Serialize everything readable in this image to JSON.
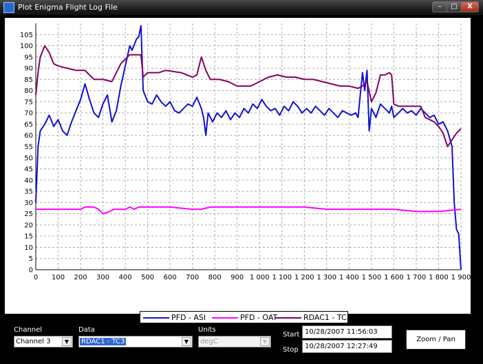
{
  "window": {
    "title": "Plot Enigma Flight Log File",
    "minimize_glyph": "–",
    "maximize_glyph": "□",
    "close_glyph": "X",
    "icon": "app-icon"
  },
  "legend": [
    {
      "name": "PFD - ASI",
      "color": "#1010d0"
    },
    {
      "name": "PFD - OAT",
      "color": "#ff00ff"
    },
    {
      "name": "RDAC1 - TC3",
      "color": "#800060"
    }
  ],
  "controls": {
    "channel": {
      "label": "Channel",
      "value": "Channel 3"
    },
    "data": {
      "label": "Data",
      "value": "RDAC1 - TC3"
    },
    "units": {
      "label": "Units",
      "value": "degC"
    },
    "start": {
      "label": "Start",
      "value": "10/28/2007 11:56:03"
    },
    "stop": {
      "label": "Stop",
      "value": "10/28/2007 12:27:49"
    },
    "zoom_button": "Zoom / Pan"
  },
  "chart_data": {
    "type": "line",
    "xlim": [
      0,
      1900
    ],
    "ylim": [
      0,
      110
    ],
    "grid": true,
    "legend_position": "bottom-center",
    "x_ticks": [
      0,
      100,
      200,
      300,
      400,
      500,
      600,
      700,
      800,
      900,
      1000,
      1100,
      1200,
      1300,
      1400,
      1500,
      1600,
      1700,
      1800,
      1900
    ],
    "x_tick_labels": [
      "0",
      "100",
      "200",
      "300",
      "400",
      "500",
      "600",
      "700",
      "800",
      "900",
      "1 000",
      "1 100",
      "1 200",
      "1 300",
      "1 400",
      "1 500",
      "1 600",
      "1 700",
      "1 800",
      "1 900"
    ],
    "y_ticks": [
      0,
      5,
      10,
      15,
      20,
      25,
      30,
      35,
      40,
      45,
      50,
      55,
      60,
      65,
      70,
      75,
      80,
      85,
      90,
      95,
      100,
      105
    ],
    "series": [
      {
        "name": "PFD - ASI",
        "color": "#1010d0",
        "points": [
          [
            0,
            30
          ],
          [
            10,
            55
          ],
          [
            20,
            62
          ],
          [
            40,
            65
          ],
          [
            60,
            69
          ],
          [
            80,
            64
          ],
          [
            100,
            67
          ],
          [
            120,
            62
          ],
          [
            140,
            60
          ],
          [
            160,
            66
          ],
          [
            180,
            71
          ],
          [
            200,
            76
          ],
          [
            220,
            83
          ],
          [
            240,
            76
          ],
          [
            260,
            70
          ],
          [
            280,
            68
          ],
          [
            300,
            74
          ],
          [
            320,
            78
          ],
          [
            340,
            66
          ],
          [
            360,
            71
          ],
          [
            380,
            82
          ],
          [
            400,
            91
          ],
          [
            420,
            100
          ],
          [
            430,
            98
          ],
          [
            450,
            103
          ],
          [
            460,
            104
          ],
          [
            470,
            109
          ],
          [
            480,
            80
          ],
          [
            500,
            75
          ],
          [
            520,
            74
          ],
          [
            540,
            78
          ],
          [
            560,
            75
          ],
          [
            580,
            73
          ],
          [
            600,
            75
          ],
          [
            620,
            71
          ],
          [
            640,
            70
          ],
          [
            660,
            72
          ],
          [
            680,
            74
          ],
          [
            700,
            73
          ],
          [
            720,
            77
          ],
          [
            740,
            72
          ],
          [
            750,
            68
          ],
          [
            760,
            60
          ],
          [
            770,
            70
          ],
          [
            790,
            66
          ],
          [
            810,
            70
          ],
          [
            830,
            68
          ],
          [
            850,
            71
          ],
          [
            870,
            67
          ],
          [
            890,
            70
          ],
          [
            910,
            68
          ],
          [
            930,
            72
          ],
          [
            950,
            70
          ],
          [
            970,
            74
          ],
          [
            990,
            72
          ],
          [
            1010,
            76
          ],
          [
            1030,
            73
          ],
          [
            1050,
            71
          ],
          [
            1070,
            72
          ],
          [
            1090,
            69
          ],
          [
            1110,
            73
          ],
          [
            1130,
            71
          ],
          [
            1150,
            75
          ],
          [
            1170,
            73
          ],
          [
            1190,
            70
          ],
          [
            1210,
            72
          ],
          [
            1230,
            70
          ],
          [
            1250,
            73
          ],
          [
            1270,
            71
          ],
          [
            1290,
            69
          ],
          [
            1310,
            72
          ],
          [
            1330,
            70
          ],
          [
            1350,
            68
          ],
          [
            1370,
            71
          ],
          [
            1390,
            70
          ],
          [
            1410,
            69
          ],
          [
            1430,
            70
          ],
          [
            1440,
            68
          ],
          [
            1450,
            78
          ],
          [
            1460,
            88
          ],
          [
            1470,
            80
          ],
          [
            1480,
            89
          ],
          [
            1490,
            62
          ],
          [
            1500,
            72
          ],
          [
            1520,
            68
          ],
          [
            1540,
            74
          ],
          [
            1560,
            72
          ],
          [
            1580,
            70
          ],
          [
            1590,
            73
          ],
          [
            1600,
            68
          ],
          [
            1620,
            70
          ],
          [
            1640,
            72
          ],
          [
            1660,
            70
          ],
          [
            1680,
            71
          ],
          [
            1700,
            69
          ],
          [
            1720,
            72
          ],
          [
            1740,
            70
          ],
          [
            1760,
            68
          ],
          [
            1780,
            69
          ],
          [
            1800,
            65
          ],
          [
            1820,
            66
          ],
          [
            1840,
            62
          ],
          [
            1860,
            55
          ],
          [
            1870,
            30
          ],
          [
            1880,
            18
          ],
          [
            1890,
            16
          ],
          [
            1900,
            0
          ]
        ]
      },
      {
        "name": "PFD - OAT",
        "color": "#ff00ff",
        "points": [
          [
            0,
            27
          ],
          [
            200,
            27
          ],
          [
            220,
            28
          ],
          [
            260,
            28
          ],
          [
            280,
            27
          ],
          [
            300,
            25
          ],
          [
            330,
            26
          ],
          [
            350,
            27
          ],
          [
            400,
            27
          ],
          [
            420,
            28
          ],
          [
            440,
            27
          ],
          [
            460,
            28
          ],
          [
            480,
            28
          ],
          [
            600,
            28
          ],
          [
            700,
            27
          ],
          [
            740,
            27
          ],
          [
            780,
            28
          ],
          [
            900,
            28
          ],
          [
            1000,
            28
          ],
          [
            1100,
            28
          ],
          [
            1200,
            28
          ],
          [
            1300,
            27
          ],
          [
            1400,
            27
          ],
          [
            1500,
            27
          ],
          [
            1600,
            27
          ],
          [
            1700,
            26
          ],
          [
            1800,
            26
          ],
          [
            1900,
            27
          ]
        ]
      },
      {
        "name": "RDAC1 - TC3",
        "color": "#800060",
        "points": [
          [
            0,
            78
          ],
          [
            10,
            88
          ],
          [
            20,
            95
          ],
          [
            40,
            100
          ],
          [
            60,
            97
          ],
          [
            80,
            92
          ],
          [
            100,
            91
          ],
          [
            140,
            90
          ],
          [
            180,
            89
          ],
          [
            220,
            89
          ],
          [
            240,
            87
          ],
          [
            260,
            85
          ],
          [
            300,
            85
          ],
          [
            340,
            84
          ],
          [
            360,
            88
          ],
          [
            380,
            92
          ],
          [
            400,
            94
          ],
          [
            420,
            96
          ],
          [
            450,
            96
          ],
          [
            470,
            96
          ],
          [
            480,
            86
          ],
          [
            500,
            88
          ],
          [
            550,
            88
          ],
          [
            580,
            89
          ],
          [
            650,
            88
          ],
          [
            700,
            86
          ],
          [
            720,
            87
          ],
          [
            730,
            91
          ],
          [
            740,
            95
          ],
          [
            760,
            89
          ],
          [
            780,
            85
          ],
          [
            820,
            85
          ],
          [
            860,
            84
          ],
          [
            900,
            82
          ],
          [
            960,
            82
          ],
          [
            1000,
            84
          ],
          [
            1040,
            86
          ],
          [
            1080,
            87
          ],
          [
            1120,
            86
          ],
          [
            1160,
            86
          ],
          [
            1200,
            85
          ],
          [
            1240,
            85
          ],
          [
            1280,
            84
          ],
          [
            1320,
            83
          ],
          [
            1360,
            82
          ],
          [
            1400,
            82
          ],
          [
            1440,
            81
          ],
          [
            1460,
            82
          ],
          [
            1480,
            84
          ],
          [
            1500,
            75
          ],
          [
            1520,
            79
          ],
          [
            1540,
            87
          ],
          [
            1560,
            87
          ],
          [
            1580,
            88
          ],
          [
            1590,
            87
          ],
          [
            1600,
            74
          ],
          [
            1620,
            73
          ],
          [
            1660,
            73
          ],
          [
            1700,
            73
          ],
          [
            1720,
            73
          ],
          [
            1740,
            68
          ],
          [
            1760,
            67
          ],
          [
            1780,
            66
          ],
          [
            1800,
            64
          ],
          [
            1820,
            61
          ],
          [
            1840,
            55
          ],
          [
            1860,
            58
          ],
          [
            1880,
            61
          ],
          [
            1900,
            63
          ]
        ]
      }
    ]
  }
}
